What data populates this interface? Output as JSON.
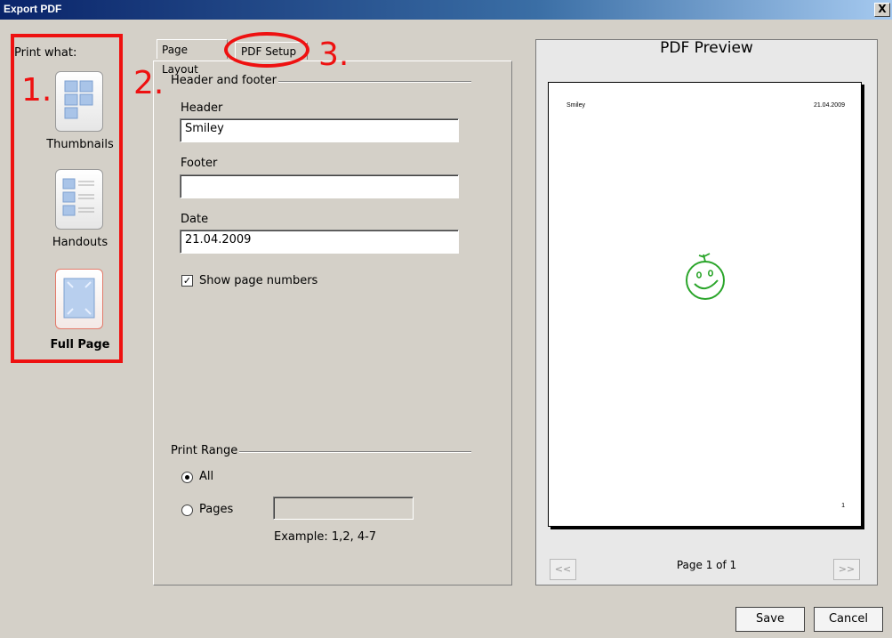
{
  "window": {
    "title": "Export PDF",
    "close_label": "X"
  },
  "left_panel": {
    "heading": "Print what:",
    "annotation_1": "1.",
    "modes": [
      {
        "label": "Thumbnails",
        "icon": "thumbnails-icon"
      },
      {
        "label": "Handouts",
        "icon": "handouts-icon"
      },
      {
        "label": "Full Page",
        "icon": "full-page-icon",
        "selected": true
      }
    ]
  },
  "annotations": {
    "two": "2.",
    "three": "3."
  },
  "tabs": [
    {
      "label": "Page Layout",
      "active": true
    },
    {
      "label": "PDF Setup",
      "active": false
    }
  ],
  "header_footer": {
    "group_title": "Header and footer",
    "header_label": "Header",
    "header_value": "Smiley",
    "footer_label": "Footer",
    "footer_value": "",
    "date_label": "Date",
    "date_value": "21.04.2009",
    "show_page_numbers_label": "Show page numbers",
    "show_page_numbers_checked": true
  },
  "print_range": {
    "group_title": "Print Range",
    "all_label": "All",
    "pages_label": "Pages",
    "pages_value": "",
    "example": "Example:  1,2, 4-7",
    "selected": "All"
  },
  "preview": {
    "title": "PDF Preview",
    "page_header_left": "Smiley",
    "page_header_right": "21.04.2009",
    "page_number": "1",
    "page_indicator": "Page 1 of 1",
    "prev_label": "<<",
    "next_label": ">>"
  },
  "buttons": {
    "save": "Save",
    "cancel": "Cancel"
  },
  "colors": {
    "annotation_red": "#e11111",
    "smiley_green": "#2aa52a",
    "title_bar": "#0a246a"
  }
}
